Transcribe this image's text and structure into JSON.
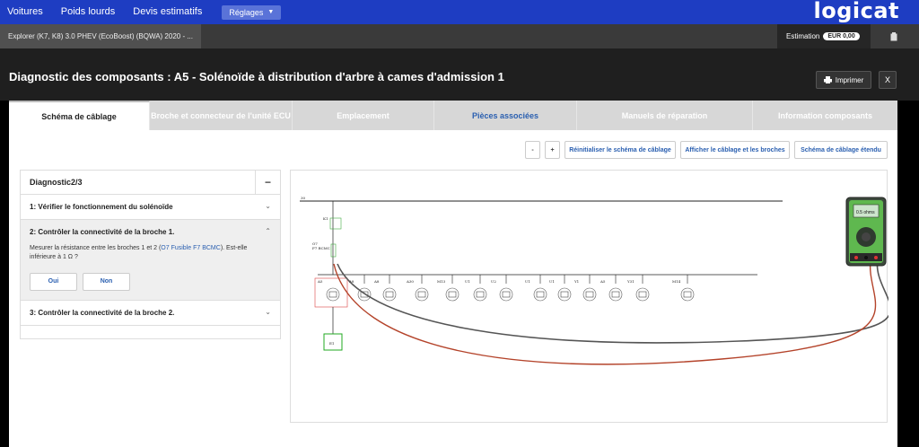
{
  "topnav": {
    "items": [
      "Voitures",
      "Poids lourds",
      "Devis estimatifs"
    ],
    "settings_label": "Réglages",
    "logo": "logicat"
  },
  "vehicle": {
    "tab_label": "Explorer (K7, K8) 3.0 PHEV (EcoBoost) (BQWA) 2020 - ..."
  },
  "estimation": {
    "label": "Estimation",
    "currency": "EUR",
    "amount": "0,00"
  },
  "header": {
    "title": "Diagnostic des composants : A5 - Solénoïde à distribution d'arbre à cames d'admission 1",
    "print_label": "Imprimer",
    "close_label": "X"
  },
  "tabs": [
    {
      "label": "Schéma de câblage"
    },
    {
      "label": "Broche et connecteur de l'unité ECU"
    },
    {
      "label": "Emplacement"
    },
    {
      "label": "Pièces associées"
    },
    {
      "label": "Manuels de réparation"
    },
    {
      "label": "Information composants"
    }
  ],
  "toolbar": {
    "zoom_out": "-",
    "zoom_in": "+",
    "reset": "Réinitialiser le schéma de câblage",
    "show": "Afficher le câblage et les broches",
    "extended": "Schéma de câblage étendu"
  },
  "diagnostic": {
    "title": "Diagnostic2/3",
    "collapse": "−",
    "steps": [
      {
        "title": "1: Vérifier le fonctionnement du solénoïde"
      },
      {
        "title": "2: Contrôler la connectivité de la broche 1.",
        "text_before": "Mesurer la résistance entre les broches 1 et 2 (",
        "link": "O7 Fusible F7 BCMC",
        "text_after": "). Est-elle inférieure à 1 Ω ?",
        "yes": "Oui",
        "no": "Non"
      },
      {
        "title": "3: Contrôler la connectivité de la broche 2."
      }
    ]
  },
  "diagram": {
    "bus_label": "30",
    "relay_label": "K1",
    "fuse_label": "O7",
    "fuse_sublabel": "F7 BCMC",
    "ground_label": "E1",
    "components": [
      "A5",
      "A8",
      "A8",
      "A30",
      "M13",
      "U1",
      "U2",
      "U1",
      "U1",
      "Y1",
      "A5",
      "Y31",
      "M14"
    ],
    "multimeter_display": "0.5 ohms"
  }
}
